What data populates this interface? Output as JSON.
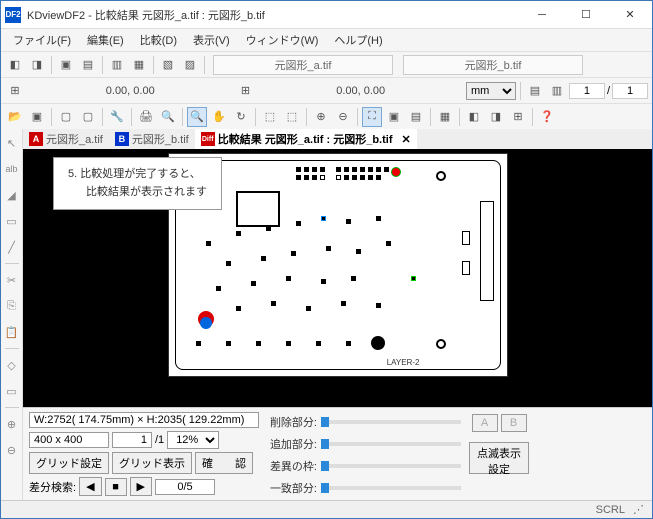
{
  "window": {
    "title": "KDviewDF2 - 比較結果 元図形_a.tif : 元図形_b.tif"
  },
  "menu": {
    "file": "ファイル(F)",
    "edit": "編集(E)",
    "compare": "比較(D)",
    "view": "表示(V)",
    "window": "ウィンドウ(W)",
    "help": "ヘルプ(H)"
  },
  "files": {
    "a": "元図形_a.tif",
    "b": "元図形_b.tif"
  },
  "coords": {
    "a": "0.00, 0.00",
    "b": "0.00, 0.00",
    "unit": "mm",
    "page_a": "1",
    "slash": "/",
    "page_b": "1"
  },
  "tabs": {
    "a": "元図形_a.tif",
    "b": "元図形_b.tif",
    "diff": "比較結果 元図形_a.tif : 元図形_b.tif"
  },
  "tooltip": {
    "line1": "5. 比較処理が完了すると、",
    "line2": "比較結果が表示されます"
  },
  "layer_label": "LAYER-2",
  "bottom": {
    "dims": "W:2752( 174.75mm) × H:2035( 129.22mm)",
    "grid": "400 x 400",
    "page": "1",
    "pages": "/1",
    "zoom": "12%",
    "grid_set": "グリッド設定",
    "grid_show": "グリッド表示",
    "confirm": "確　　認",
    "diff_search": "差分検索:",
    "diff_pos": "0/5",
    "del": "削除部分:",
    "add": "追加部分:",
    "frame": "差異の枠:",
    "match": "一致部分:",
    "a_btn": "A",
    "b_btn": "B",
    "blink": "点滅表示\n設定"
  },
  "status": {
    "scrl": "SCRL"
  }
}
